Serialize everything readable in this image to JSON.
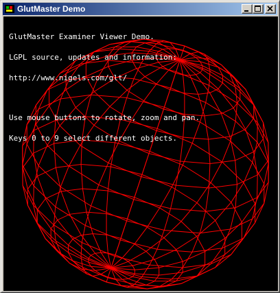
{
  "window": {
    "title": "GlutMaster Demo",
    "controls": {
      "minimize_icon": "minimize-icon",
      "maximize_icon": "maximize-icon",
      "close_icon": "close-icon"
    }
  },
  "overlay": {
    "lines": [
      "GlutMaster Examiner Viewer Demo.",
      "LGPL source, updates and information:",
      "http://www.nigels.com/glt/"
    ],
    "help_lines": [
      "Use mouse buttons to rotate, zoom and pan.",
      "Keys 0 to 9 select different objects."
    ]
  },
  "scene": {
    "object": "wireframe-sphere",
    "wire_color": "#ff0000",
    "background_color": "#000000"
  }
}
